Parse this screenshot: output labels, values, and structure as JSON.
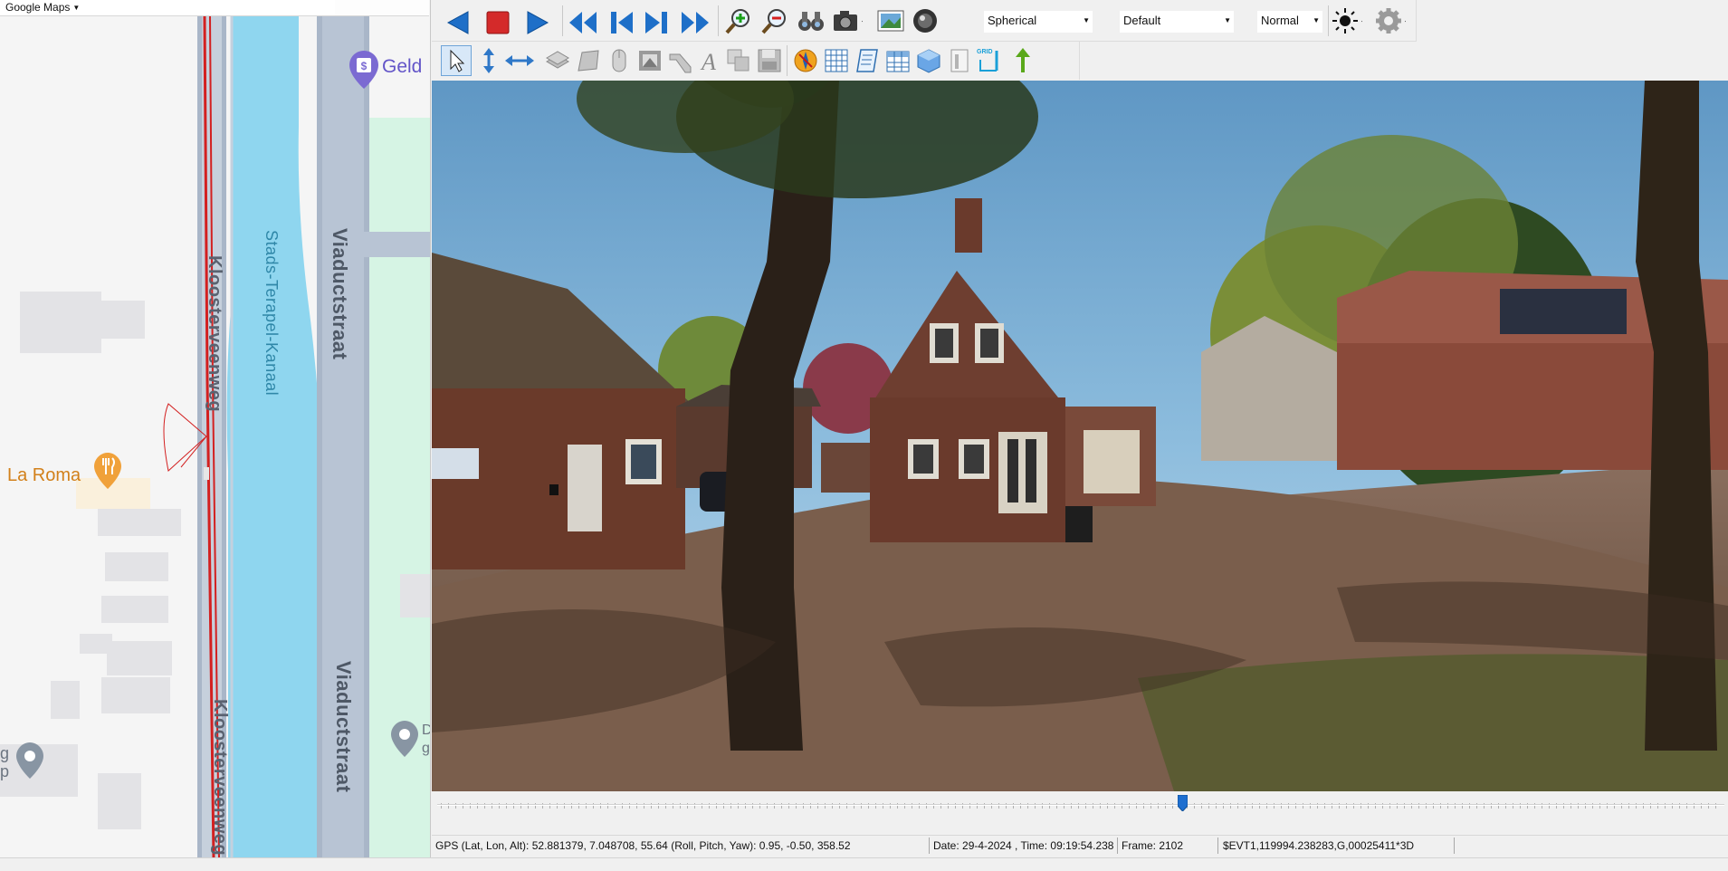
{
  "map": {
    "header_label": "Google Maps",
    "streets": {
      "klooster_top": "Kloosterveenweg",
      "klooster_bottom": "Kloosterveenweg",
      "canal": "Stads-Terapel-Kanaal",
      "viaduct_top": "Viaductstraat",
      "viaduct_bottom": "Viaductstraat"
    },
    "pois": {
      "restaurant": "La Roma",
      "bank": "Geld",
      "poi_left_a": "g",
      "poi_left_b": "p",
      "poi_right_a": "D",
      "poi_right_b": "g"
    },
    "colors": {
      "canal": "#8fd6ef",
      "road": "#a9b6c8",
      "route": "#d32020",
      "park": "#d4f3e3",
      "poi_food": "#f0a13a"
    }
  },
  "toolbar": {
    "row1_icons": [
      "previous-icon",
      "stop-icon",
      "play-icon",
      "rewind-icon",
      "step-back-icon",
      "step-forward-icon",
      "fast-forward-icon",
      "zoom-in-icon",
      "zoom-out-icon",
      "binoculars-icon",
      "camera-icon",
      "image-icon",
      "lens-icon",
      "brightness-icon",
      "settings-icon"
    ],
    "projection_select": "Spherical",
    "profile_select": "Default",
    "mode_select": "Normal",
    "row2_icons": [
      "pointer-icon",
      "vertical-measure-icon",
      "horizontal-measure-icon",
      "layers-icon",
      "area-icon",
      "mouse-icon",
      "frame-icon",
      "pipe-icon",
      "text-icon",
      "copy-icon",
      "save-icon",
      "compass-icon",
      "grid-icon",
      "script-icon",
      "table-icon",
      "cube-icon",
      "document-icon",
      "grid-height-icon",
      "arrow-up-icon"
    ]
  },
  "timeline": {
    "position_fraction": 0.58
  },
  "status": {
    "gps": "GPS (Lat, Lon, Alt): 52.881379, 7.048708, 55.64  (Roll, Pitch, Yaw): 0.95, -0.50, 358.52",
    "datetime": "Date: 29-4-2024 , Time: 09:19:54.238",
    "frame": "Frame: 2102",
    "evt": "$EVT1,119994.238283,G,00025411*3D"
  }
}
